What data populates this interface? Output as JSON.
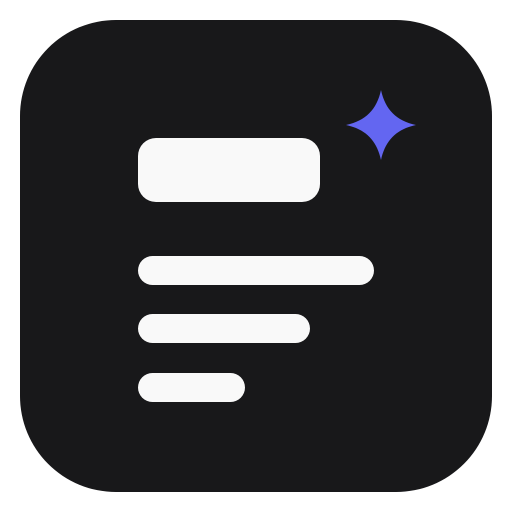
{
  "icon": {
    "kind": "document-sparkle-app-icon",
    "background_color": "#18181a",
    "content_color": "#f9f9f9",
    "accent_color": "#6366f1",
    "elements": {
      "title_block": "title-bar",
      "text_lines": [
        "long-line",
        "medium-line",
        "short-line"
      ],
      "sparkle": "sparkle-icon"
    }
  }
}
